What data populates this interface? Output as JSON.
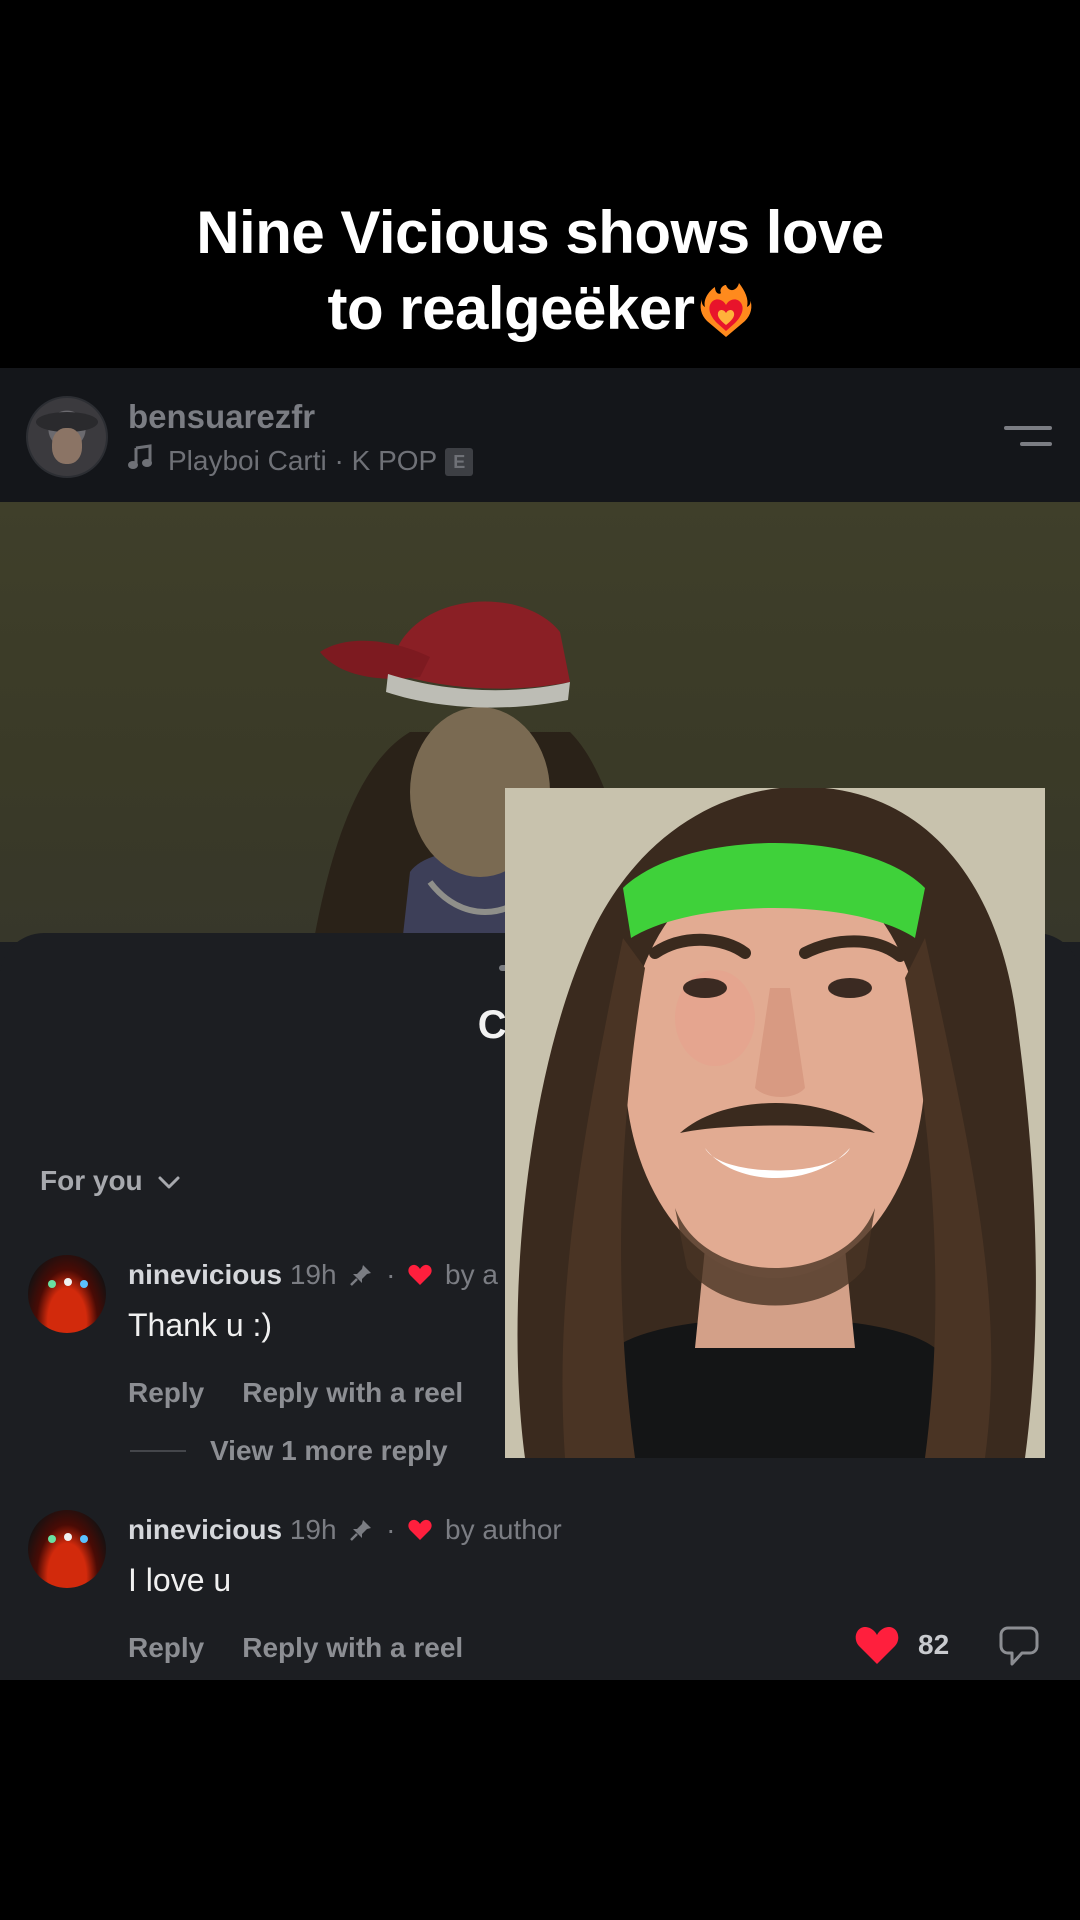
{
  "caption": {
    "line1": "Nine Vicious shows love",
    "line2": "to realgeëker"
  },
  "post_header": {
    "username": "bensuarezfr",
    "music": "Playboi Carti · K POP",
    "explicit": "E"
  },
  "comments_sheet": {
    "title": "Comm",
    "filter_label": "For you",
    "comments": [
      {
        "username": "ninevicious",
        "time": "19h",
        "meta": "by a",
        "text": "Thank u :)",
        "reply_label": "Reply",
        "reply_reel_label": "Reply with a reel",
        "view_more": "View 1 more reply"
      },
      {
        "username": "ninevicious",
        "time": "19h",
        "meta": "by author",
        "text": "I love u",
        "reply_label": "Reply",
        "reply_reel_label": "Reply with a reel",
        "likes": "82"
      }
    ]
  },
  "colors": {
    "background": "#000000",
    "sheet": "#1c1e22",
    "heart_red": "#ff1f3d",
    "headband_green": "#3fd13a"
  },
  "icons": [
    "music-note-icon",
    "menu-icon",
    "chevron-down-icon",
    "pin-icon",
    "red-heart-icon",
    "heart-icon",
    "dislike-icon",
    "heart-on-fire-emoji"
  ]
}
